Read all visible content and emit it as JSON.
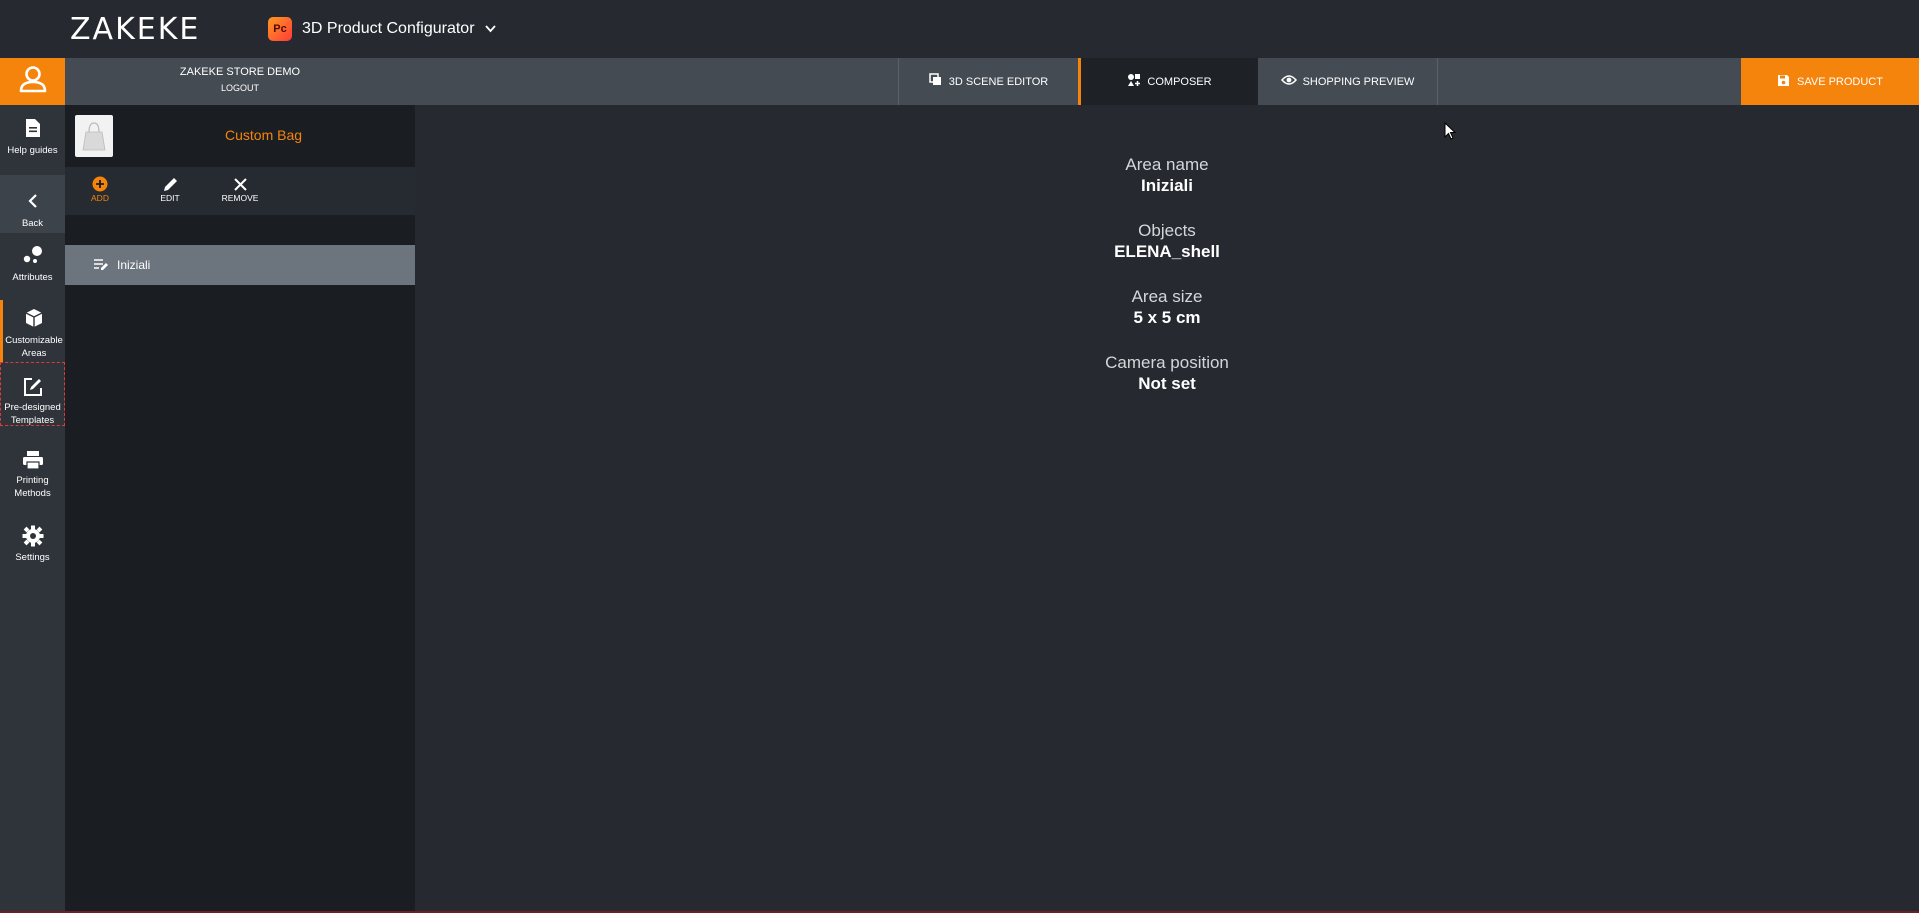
{
  "brand": {
    "logo_text": "ZAKEKE"
  },
  "app_switcher": {
    "badge": "Pc",
    "name": "3D Product Configurator"
  },
  "store": {
    "name": "ZAKEKE STORE DEMO",
    "logout": "LOGOUT"
  },
  "tabs": [
    {
      "label": "3D SCENE EDITOR",
      "icon": "layers-icon"
    },
    {
      "label": "COMPOSER",
      "icon": "shapes-icon",
      "active": true
    },
    {
      "label": "SHOPPING PREVIEW",
      "icon": "eye-icon"
    }
  ],
  "save_button": {
    "label": "SAVE PRODUCT"
  },
  "rail": {
    "items": [
      {
        "label": "Help guides"
      },
      {
        "label": "Back"
      },
      {
        "label": "Attributes"
      },
      {
        "label": "Customizable Areas"
      },
      {
        "label": "Pre-designed Templates"
      },
      {
        "label": "Printing Methods"
      },
      {
        "label": "Settings"
      }
    ]
  },
  "panel": {
    "product_name": "Custom Bag",
    "actions": {
      "add": "ADD",
      "edit": "EDIT",
      "remove": "REMOVE"
    },
    "areas": [
      {
        "label": "Iniziali"
      }
    ]
  },
  "details": {
    "area_name_label": "Area name",
    "area_name_value": "Iniziali",
    "objects_label": "Objects",
    "objects_value": "ELENA_shell",
    "area_size_label": "Area size",
    "area_size_value": "5 x 5 cm",
    "camera_label": "Camera position",
    "camera_value": "Not set"
  },
  "colors": {
    "accent": "#f5840c",
    "background": "#262a30",
    "panel": "#1a1d21"
  }
}
